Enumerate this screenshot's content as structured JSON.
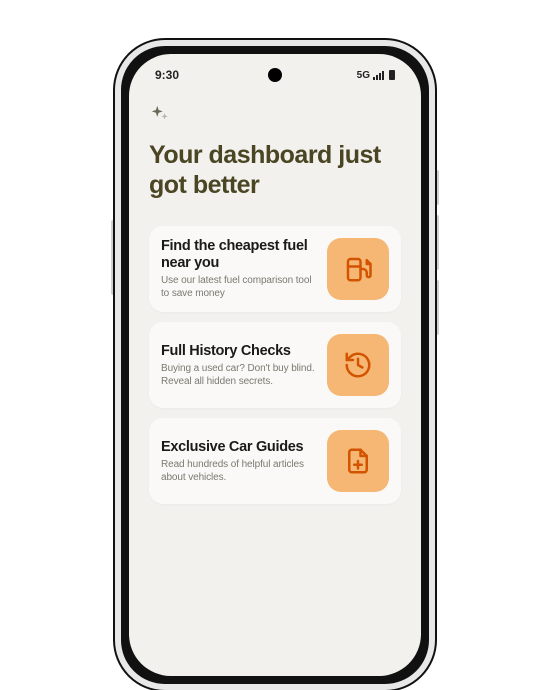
{
  "status": {
    "time": "9:30",
    "net": "5G"
  },
  "headline": "Your dashboard just got better",
  "cards": [
    {
      "title": "Find the cheapest fuel near you",
      "sub": "Use our latest fuel comparison tool to save money",
      "icon": "fuel-pump-icon"
    },
    {
      "title": "Full History Checks",
      "sub": "Buying a used car? Don't buy blind. Reveal all hidden secrets.",
      "icon": "history-icon"
    },
    {
      "title": "Exclusive Car Guides",
      "sub": "Read hundreds of helpful articles about vehicles.",
      "icon": "document-plus-icon"
    }
  ],
  "colors": {
    "accent": "#d35400",
    "accent_bg": "#f6b774",
    "headline": "#4a4523"
  }
}
